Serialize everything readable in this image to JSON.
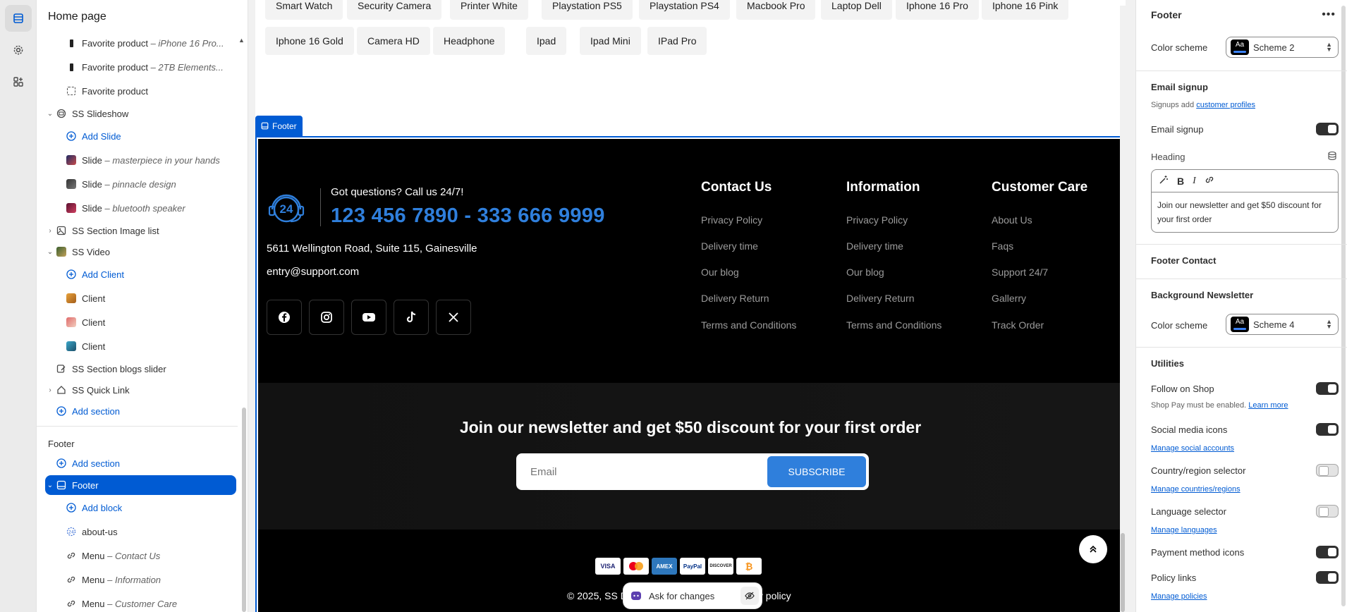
{
  "tree": {
    "title": "Home page",
    "rows": [
      {
        "label": "Favorite product",
        "detail": "– iPhone 16 Pro...",
        "kind": "product"
      },
      {
        "label": "Favorite product",
        "detail": "– 2TB Elements...",
        "kind": "product"
      },
      {
        "label": "Favorite product",
        "detail": "",
        "kind": "empty"
      },
      {
        "label": "SS Slideshow",
        "detail": "",
        "kind": "section"
      },
      {
        "label": "Add Slide",
        "detail": "",
        "kind": "add"
      },
      {
        "label": "Slide",
        "detail": "– masterpiece in your hands",
        "kind": "img"
      },
      {
        "label": "Slide",
        "detail": "– pinnacle design",
        "kind": "img"
      },
      {
        "label": "Slide",
        "detail": "– bluetooth speaker",
        "kind": "img"
      },
      {
        "label": "SS Section Image list",
        "detail": "",
        "kind": "section"
      },
      {
        "label": "SS Video",
        "detail": "",
        "kind": "section"
      },
      {
        "label": "Add Client",
        "detail": "",
        "kind": "add"
      },
      {
        "label": "Client",
        "detail": "",
        "kind": "img"
      },
      {
        "label": "Client",
        "detail": "",
        "kind": "img"
      },
      {
        "label": "Client",
        "detail": "",
        "kind": "img"
      },
      {
        "label": "SS Section blogs slider",
        "detail": "",
        "kind": "section"
      },
      {
        "label": "SS Quick Link",
        "detail": "",
        "kind": "section"
      },
      {
        "label": "Add section",
        "detail": "",
        "kind": "add"
      }
    ],
    "footer_group": "Footer",
    "footer_rows": [
      {
        "label": "Add section",
        "detail": ""
      },
      {
        "label": "Footer",
        "detail": ""
      },
      {
        "label": "Add block",
        "detail": ""
      },
      {
        "label": "about-us",
        "detail": ""
      },
      {
        "label": "Menu",
        "detail": "– Contact Us"
      },
      {
        "label": "Menu",
        "detail": "– Information"
      },
      {
        "label": "Menu",
        "detail": "– Customer Care"
      }
    ]
  },
  "preview": {
    "tags_row1": [
      "Smart Watch",
      "Security Camera",
      "Printer White",
      "Playstation PS5",
      "Playstation PS4",
      "Macbook Pro",
      "Laptop Dell",
      "Iphone 16 Pro",
      "Iphone 16 Pink"
    ],
    "tags_row2": [
      "Iphone 16 Gold",
      "Camera HD",
      "Headphone",
      "Ipad",
      "Ipad Mini",
      "IPad Pro"
    ],
    "section_label": "Footer",
    "contact": {
      "question": "Got questions? Call us 24/7!",
      "phone": "123 456 7890 - 333 666 9999",
      "address": "5611 Wellington Road, Suite 115, Gainesville",
      "email": "entry@support.com",
      "hours_badge": "24"
    },
    "columns": [
      {
        "title": "Contact Us",
        "links": [
          "Privacy Policy",
          "Delivery time",
          "Our blog",
          "Delivery Return",
          "Terms and Conditions"
        ]
      },
      {
        "title": "Information",
        "links": [
          "Privacy Policy",
          "Delivery time",
          "Our blog",
          "Delivery Return",
          "Terms and Conditions"
        ]
      },
      {
        "title": "Customer Care",
        "links": [
          "About Us",
          "Faqs",
          "Support 24/7",
          "Gallerry",
          "Track Order"
        ]
      }
    ],
    "social": [
      "facebook-icon",
      "instagram-icon",
      "youtube-icon",
      "tiktok-icon",
      "x-icon"
    ],
    "newsletter": {
      "heading": "Join our newsletter and get $50 discount for your first order",
      "placeholder": "Email",
      "button": "SUBSCRIBE"
    },
    "payments": [
      "VISA",
      "MC",
      "AMEX",
      "PayPal",
      "DISCOVER",
      "₿"
    ],
    "copyright": "© 2025, SS D",
    "policy": "Privacy policy",
    "ask": "Ask for changes",
    "accent": "#2f7fdc"
  },
  "settings": {
    "title": "Footer",
    "color_scheme_label": "Color scheme",
    "scheme_value": "Scheme 2",
    "email_signup_head": "Email signup",
    "signups_text": "Signups add ",
    "signups_link": "customer profiles",
    "email_signup_toggle": "Email signup",
    "heading_label": "Heading",
    "heading_value": "Join our newsletter and get $50 discount for your first order",
    "footer_contact": "Footer Contact",
    "bg_newsletter": "Background Newsletter",
    "color_scheme_label2": "Color scheme",
    "scheme_value2": "Scheme 4",
    "utilities": "Utilities",
    "follow_shop": "Follow on Shop",
    "shop_pay_note": "Shop Pay must be enabled. ",
    "learn_more": "Learn more",
    "social_icons": "Social media icons",
    "manage_social": "Manage social accounts",
    "country_selector": "Country/region selector",
    "manage_countries": "Manage countries/regions",
    "language_selector": "Language selector",
    "manage_languages": "Manage languages",
    "payment_icons": "Payment method icons",
    "policy_links": "Policy links",
    "manage_policies": "Manage policies",
    "scheme_swatch": "Aa",
    "toggles": {
      "email_signup": true,
      "follow_shop": true,
      "social_icons": true,
      "country": false,
      "language": false,
      "payment": true,
      "policy": true
    }
  }
}
